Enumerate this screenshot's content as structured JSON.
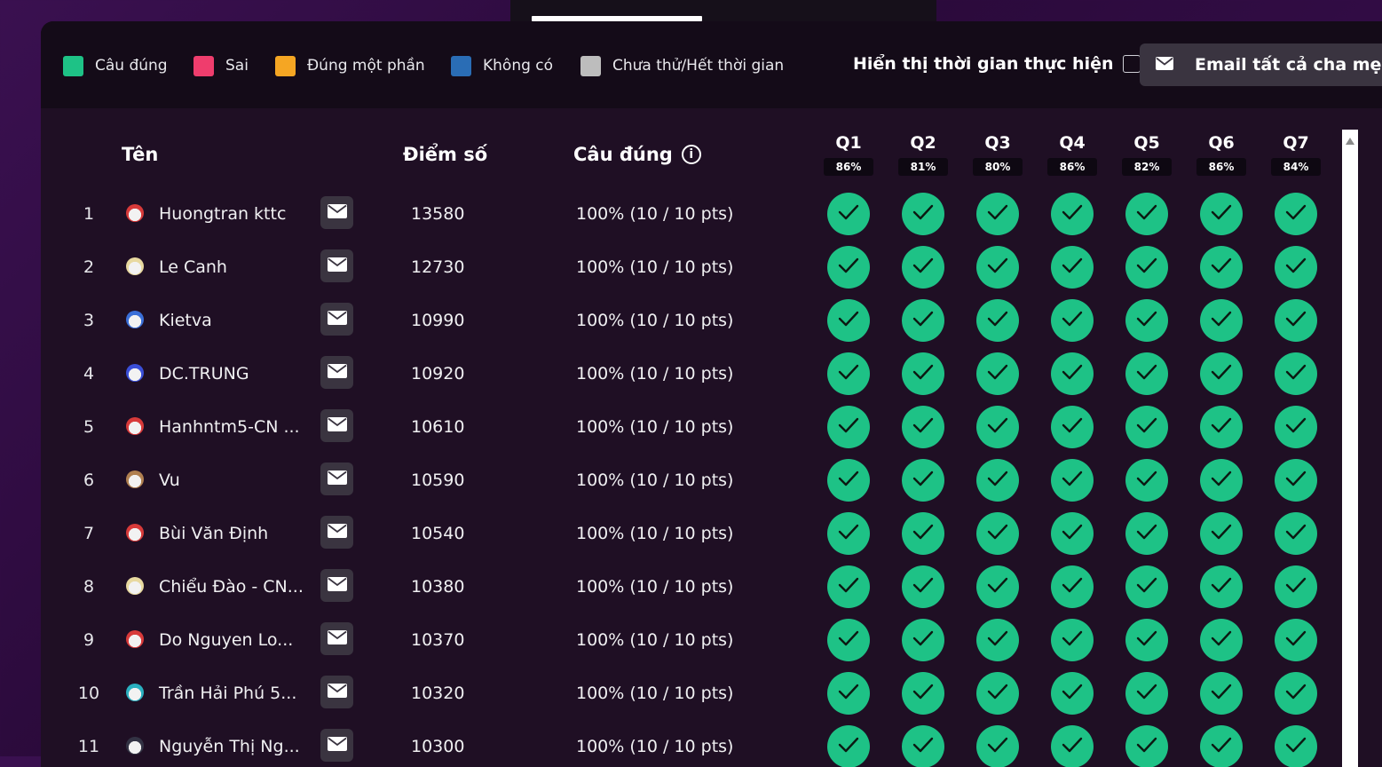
{
  "legend": [
    {
      "label": "Câu đúng",
      "color": "#1ec286"
    },
    {
      "label": "Sai",
      "color": "#ef3d6d"
    },
    {
      "label": "Đúng một phần",
      "color": "#f5a623"
    },
    {
      "label": "Không có",
      "color": "#2a6db5"
    },
    {
      "label": "Chưa thử/Hết thời gian",
      "color": "#bdbdbd"
    }
  ],
  "time_toggle_label": "Hiển thị thời gian thực hiện",
  "email_all_label": "Email tất cả cha mẹ",
  "headers": {
    "name": "Tên",
    "score": "Điểm số",
    "correct": "Câu đúng"
  },
  "questions": [
    {
      "label": "Q1",
      "pct": "86%"
    },
    {
      "label": "Q2",
      "pct": "81%"
    },
    {
      "label": "Q3",
      "pct": "80%"
    },
    {
      "label": "Q4",
      "pct": "86%"
    },
    {
      "label": "Q5",
      "pct": "82%"
    },
    {
      "label": "Q6",
      "pct": "86%"
    },
    {
      "label": "Q7",
      "pct": "84%"
    }
  ],
  "rows": [
    {
      "rank": "1",
      "name": "Huongtran kttc",
      "score": "13580",
      "correct": "100% (10 / 10 pts)",
      "avatar_color": "#d83a3a"
    },
    {
      "rank": "2",
      "name": "Le Canh",
      "score": "12730",
      "correct": "100% (10 / 10 pts)",
      "avatar_color": "#e8d9a0"
    },
    {
      "rank": "3",
      "name": "Kietva",
      "score": "10990",
      "correct": "100% (10 / 10 pts)",
      "avatar_color": "#3a6fd8"
    },
    {
      "rank": "4",
      "name": "DC.TRUNG",
      "score": "10920",
      "correct": "100% (10 / 10 pts)",
      "avatar_color": "#3a4fd8"
    },
    {
      "rank": "5",
      "name": "Hanhntm5-CN ...",
      "score": "10610",
      "correct": "100% (10 / 10 pts)",
      "avatar_color": "#d83a3a"
    },
    {
      "rank": "6",
      "name": "Vu",
      "score": "10590",
      "correct": "100% (10 / 10 pts)",
      "avatar_color": "#b08050"
    },
    {
      "rank": "7",
      "name": "Bùi Văn Định",
      "score": "10540",
      "correct": "100% (10 / 10 pts)",
      "avatar_color": "#d83a3a"
    },
    {
      "rank": "8",
      "name": "Chiểu Đào - CN...",
      "score": "10380",
      "correct": "100% (10 / 10 pts)",
      "avatar_color": "#e8d9a0"
    },
    {
      "rank": "9",
      "name": "Do Nguyen Lo...",
      "score": "10370",
      "correct": "100% (10 / 10 pts)",
      "avatar_color": "#d83a3a"
    },
    {
      "rank": "10",
      "name": "Trần Hải Phú 5...",
      "score": "10320",
      "correct": "100% (10 / 10 pts)",
      "avatar_color": "#2ab0c0"
    },
    {
      "rank": "11",
      "name": "Nguyễn Thị Ng...",
      "score": "10300",
      "correct": "100% (10 / 10 pts)",
      "avatar_color": "#333344"
    }
  ],
  "answer_state": "correct",
  "answer_icon": "check-icon"
}
